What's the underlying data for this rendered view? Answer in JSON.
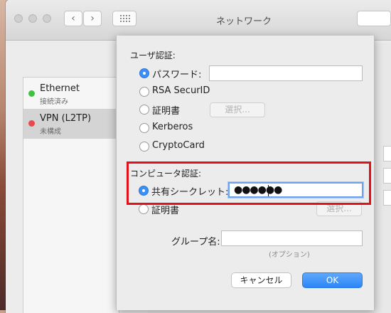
{
  "window": {
    "title": "ネットワーク",
    "nav_back": "‹",
    "nav_forward": "›"
  },
  "services": [
    {
      "name": "Ethernet",
      "status": "接続済み",
      "status_color": "#3fc23f"
    },
    {
      "name": "VPN (L2TP)",
      "status": "未構成",
      "status_color": "#ec4a4a"
    }
  ],
  "sheet": {
    "user_auth": {
      "heading": "ユーザ認証:",
      "options": [
        {
          "label": "パスワード:",
          "selected": true
        },
        {
          "label": "RSA SecurID",
          "selected": false
        },
        {
          "label": "証明書",
          "selected": false
        },
        {
          "label": "Kerberos",
          "selected": false
        },
        {
          "label": "CryptoCard",
          "selected": false
        }
      ],
      "password_value": "",
      "cert_select_button": "選択..."
    },
    "machine_auth": {
      "heading": "コンピュータ認証:",
      "options": [
        {
          "label": "共有シークレット:",
          "selected": true
        },
        {
          "label": "証明書",
          "selected": false
        }
      ],
      "shared_secret_value": "●●●●●●",
      "cert_select_button": "選択...",
      "group_label": "グループ名:",
      "group_value": "",
      "group_hint": "(オプション)"
    },
    "cancel_button": "キャンセル",
    "ok_button": "OK"
  },
  "accent_color": "#3b8ff5",
  "annotation_color": "#e3101a"
}
